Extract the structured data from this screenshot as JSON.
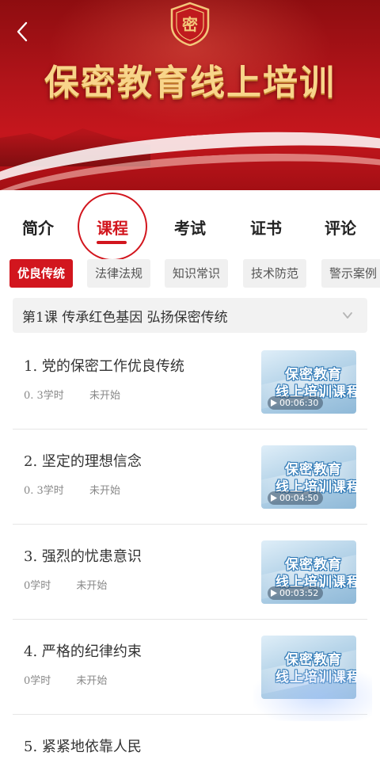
{
  "banner": {
    "title": "保密教育线上培训",
    "emblem_text": "密"
  },
  "tabs": [
    {
      "label": "简介",
      "active": false
    },
    {
      "label": "课程",
      "active": true
    },
    {
      "label": "考试",
      "active": false
    },
    {
      "label": "证书",
      "active": false
    },
    {
      "label": "评论",
      "active": false
    }
  ],
  "categories": [
    {
      "label": "优良传统",
      "active": true
    },
    {
      "label": "法律法规",
      "active": false
    },
    {
      "label": "知识常识",
      "active": false
    },
    {
      "label": "技术防范",
      "active": false
    },
    {
      "label": "警示案例",
      "active": false
    }
  ],
  "lesson": {
    "title": "第1课  传承红色基因  弘扬保密传统"
  },
  "thumbnail": {
    "line1": "保密教育",
    "line2": "线上培训课程"
  },
  "courses": [
    {
      "title": "1. 党的保密工作优良传统",
      "hours": "0. 3学时",
      "status": "未开始",
      "duration": "00:06:30"
    },
    {
      "title": "2. 坚定的理想信念",
      "hours": "0. 3学时",
      "status": "未开始",
      "duration": "00:04:50"
    },
    {
      "title": "3. 强烈的忧患意识",
      "hours": "0学时",
      "status": "未开始",
      "duration": "00:03:52"
    },
    {
      "title": "4. 严格的纪律约束",
      "hours": "0学时",
      "status": "未开始",
      "duration": ""
    },
    {
      "title": "5. 紧紧地依靠人民",
      "hours": "",
      "status": "",
      "duration": ""
    }
  ],
  "colors": {
    "accent": "#d2161e",
    "banner_gold": "#f8d58a"
  }
}
